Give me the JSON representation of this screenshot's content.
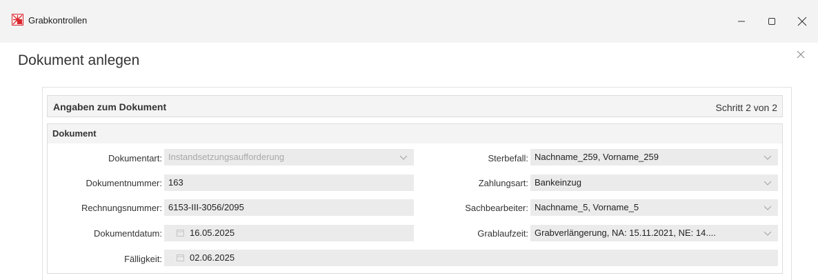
{
  "window": {
    "title": "Grabkontrollen",
    "brand_color": "#d9262c"
  },
  "dialog": {
    "title": "Dokument anlegen"
  },
  "panel": {
    "title": "Angaben zum Dokument",
    "step": "Schritt 2 von 2"
  },
  "section": {
    "title": "Dokument"
  },
  "left_fields": {
    "dokumentart": {
      "label": "Dokumentart:",
      "value": "Instandsetzungsaufforderung",
      "disabled": true
    },
    "dokumentnummer": {
      "label": "Dokumentnummer:",
      "value": "163"
    },
    "rechnungsnummer": {
      "label": "Rechnungsnummer:",
      "value": "6153-III-3056/2095"
    },
    "dokumentdatum": {
      "label": "Dokumentdatum:",
      "value": "16.05.2025"
    },
    "faelligkeit": {
      "label": "Fälligkeit:",
      "value": "02.06.2025"
    }
  },
  "right_fields": {
    "sterbefall": {
      "label": "Sterbefall:",
      "value": "Nachname_259, Vorname_259"
    },
    "zahlungsart": {
      "label": "Zahlungsart:",
      "value": "Bankeinzug"
    },
    "sachbearbeiter": {
      "label": "Sachbearbeiter:",
      "value": "Nachname_5, Vorname_5"
    },
    "grablaufzeit": {
      "label": "Grablaufzeit:",
      "value": "Grabverlängerung, NA: 15.11.2021, NE: 14...."
    }
  }
}
